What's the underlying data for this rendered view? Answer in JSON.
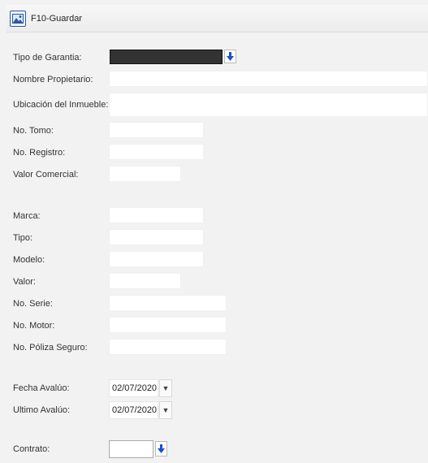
{
  "toolbar": {
    "save_label": "F10-Guardar"
  },
  "form": {
    "tipo_garantia": "Tipo de Garantia:",
    "nombre_propietario": "Nombre Propietario:",
    "ubicacion_inmueble": "Ubicación del Inmueble:",
    "no_tomo": "No. Tomo:",
    "no_registro": "No. Registro:",
    "valor_comercial": "Valor Comercial:",
    "marca": "Marca:",
    "tipo": "Tipo:",
    "modelo": "Modelo:",
    "valor": "Valor:",
    "no_serie": "No. Serie:",
    "no_motor": "No. Motor:",
    "no_poliza": "No. Póliza Seguro:",
    "fecha_avaluo": "Fecha Avalúo:",
    "fecha_avaluo_value": "02/07/2020",
    "ultimo_avaluo": "Ultimo Avalúo:",
    "ultimo_avaluo_value": "02/07/2020",
    "contrato": "Contrato:"
  },
  "icons": {
    "save": "save-icon",
    "arrow_down": "arrow-down-icon",
    "caret_down": "caret-down-icon"
  },
  "colors": {
    "accent": "#1a4fd6",
    "select_dark": "#333333"
  }
}
